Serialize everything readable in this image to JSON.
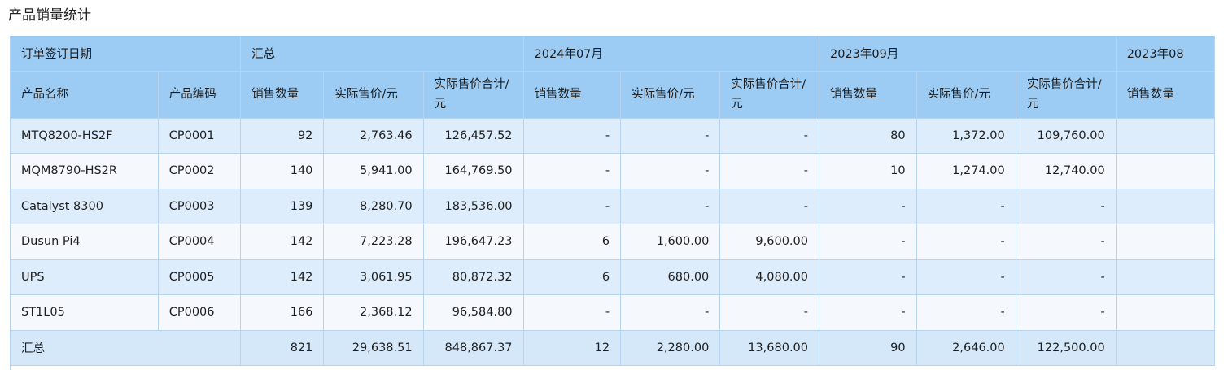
{
  "page_title": "产品销量统计",
  "header_row1": {
    "order_date": "订单签订日期",
    "summary": "汇总",
    "period1": "2024年07月",
    "period2": "2023年09月",
    "period3": "2023年08"
  },
  "header_row2": {
    "product_name": "产品名称",
    "product_code": "产品编码",
    "qty": "销售数量",
    "price": "实际售价/元",
    "total": "实际售价合计/元"
  },
  "rows": [
    {
      "name": "MTQ8200-HS2F",
      "code": "CP0001",
      "sum_qty": "92",
      "sum_price": "2,763.46",
      "sum_total": "126,457.52",
      "p1_qty": "-",
      "p1_price": "-",
      "p1_total": "-",
      "p2_qty": "80",
      "p2_price": "1,372.00",
      "p2_total": "109,760.00"
    },
    {
      "name": "MQM8790-HS2R",
      "code": "CP0002",
      "sum_qty": "140",
      "sum_price": "5,941.00",
      "sum_total": "164,769.50",
      "p1_qty": "-",
      "p1_price": "-",
      "p1_total": "-",
      "p2_qty": "10",
      "p2_price": "1,274.00",
      "p2_total": "12,740.00"
    },
    {
      "name": "Catalyst 8300",
      "code": "CP0003",
      "sum_qty": "139",
      "sum_price": "8,280.70",
      "sum_total": "183,536.00",
      "p1_qty": "-",
      "p1_price": "-",
      "p1_total": "-",
      "p2_qty": "-",
      "p2_price": "-",
      "p2_total": "-"
    },
    {
      "name": "Dusun Pi4",
      "code": "CP0004",
      "sum_qty": "142",
      "sum_price": "7,223.28",
      "sum_total": "196,647.23",
      "p1_qty": "6",
      "p1_price": "1,600.00",
      "p1_total": "9,600.00",
      "p2_qty": "-",
      "p2_price": "-",
      "p2_total": "-"
    },
    {
      "name": "UPS",
      "code": "CP0005",
      "sum_qty": "142",
      "sum_price": "3,061.95",
      "sum_total": "80,872.32",
      "p1_qty": "6",
      "p1_price": "680.00",
      "p1_total": "4,080.00",
      "p2_qty": "-",
      "p2_price": "-",
      "p2_total": "-"
    },
    {
      "name": "ST1L05",
      "code": "CP0006",
      "sum_qty": "166",
      "sum_price": "2,368.12",
      "sum_total": "96,584.80",
      "p1_qty": "-",
      "p1_price": "-",
      "p1_total": "-",
      "p2_qty": "-",
      "p2_price": "-",
      "p2_total": "-"
    }
  ],
  "total_row": {
    "label": "汇总",
    "sum_qty": "821",
    "sum_price": "29,638.51",
    "sum_total": "848,867.37",
    "p1_qty": "12",
    "p1_price": "2,280.00",
    "p1_total": "13,680.00",
    "p2_qty": "90",
    "p2_price": "2,646.00",
    "p2_total": "122,500.00"
  }
}
